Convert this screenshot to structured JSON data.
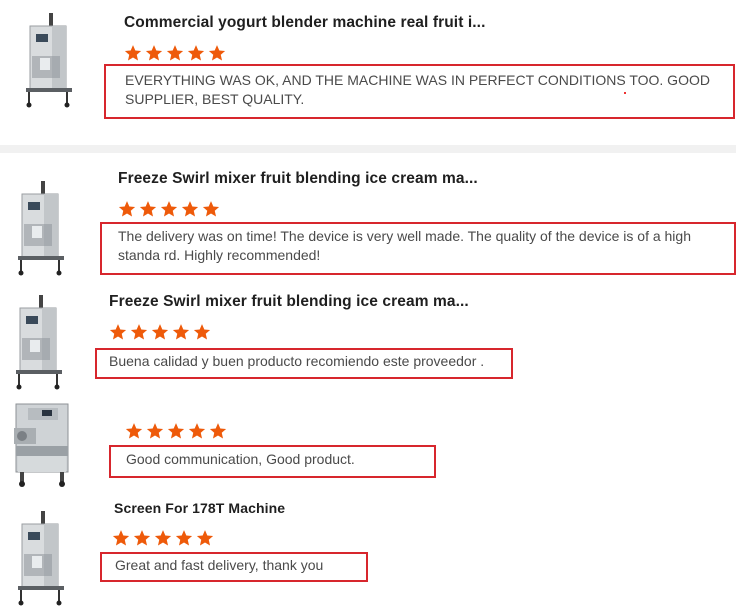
{
  "reviews": [
    {
      "product_title": "Commercial yogurt blender machine real fruit i...",
      "rating": 5,
      "comment": "EVERYTHING WAS OK, AND THE MACHINE WAS IN PERFECT CONDITIONS TOO. GOOD SUPPLIER, BEST QUALITY.",
      "thumbnail": "blender-machine-icon"
    },
    {
      "product_title": "Freeze Swirl mixer fruit blending ice cream ma...",
      "rating": 5,
      "comment": "The delivery was on time! The device is very well made. The quality of the device is of a high standa rd. Highly recommended!",
      "thumbnail": "blender-machine-icon"
    },
    {
      "product_title": "Freeze Swirl mixer fruit blending ice cream ma...",
      "rating": 5,
      "comment": "Buena calidad y buen producto recomiendo este proveedor .",
      "thumbnail": "blender-machine-icon"
    },
    {
      "product_title": "",
      "rating": 5,
      "comment": "Good communication, Good product.",
      "thumbnail": "batch-freezer-icon"
    },
    {
      "product_title": "Screen For 178T Machine",
      "rating": 5,
      "comment": "Great and fast delivery, thank you",
      "thumbnail": "blender-machine-icon"
    }
  ],
  "colors": {
    "star": "#ee5a0a",
    "highlight_border": "#d7262d",
    "divider": "#f1f1f1"
  }
}
